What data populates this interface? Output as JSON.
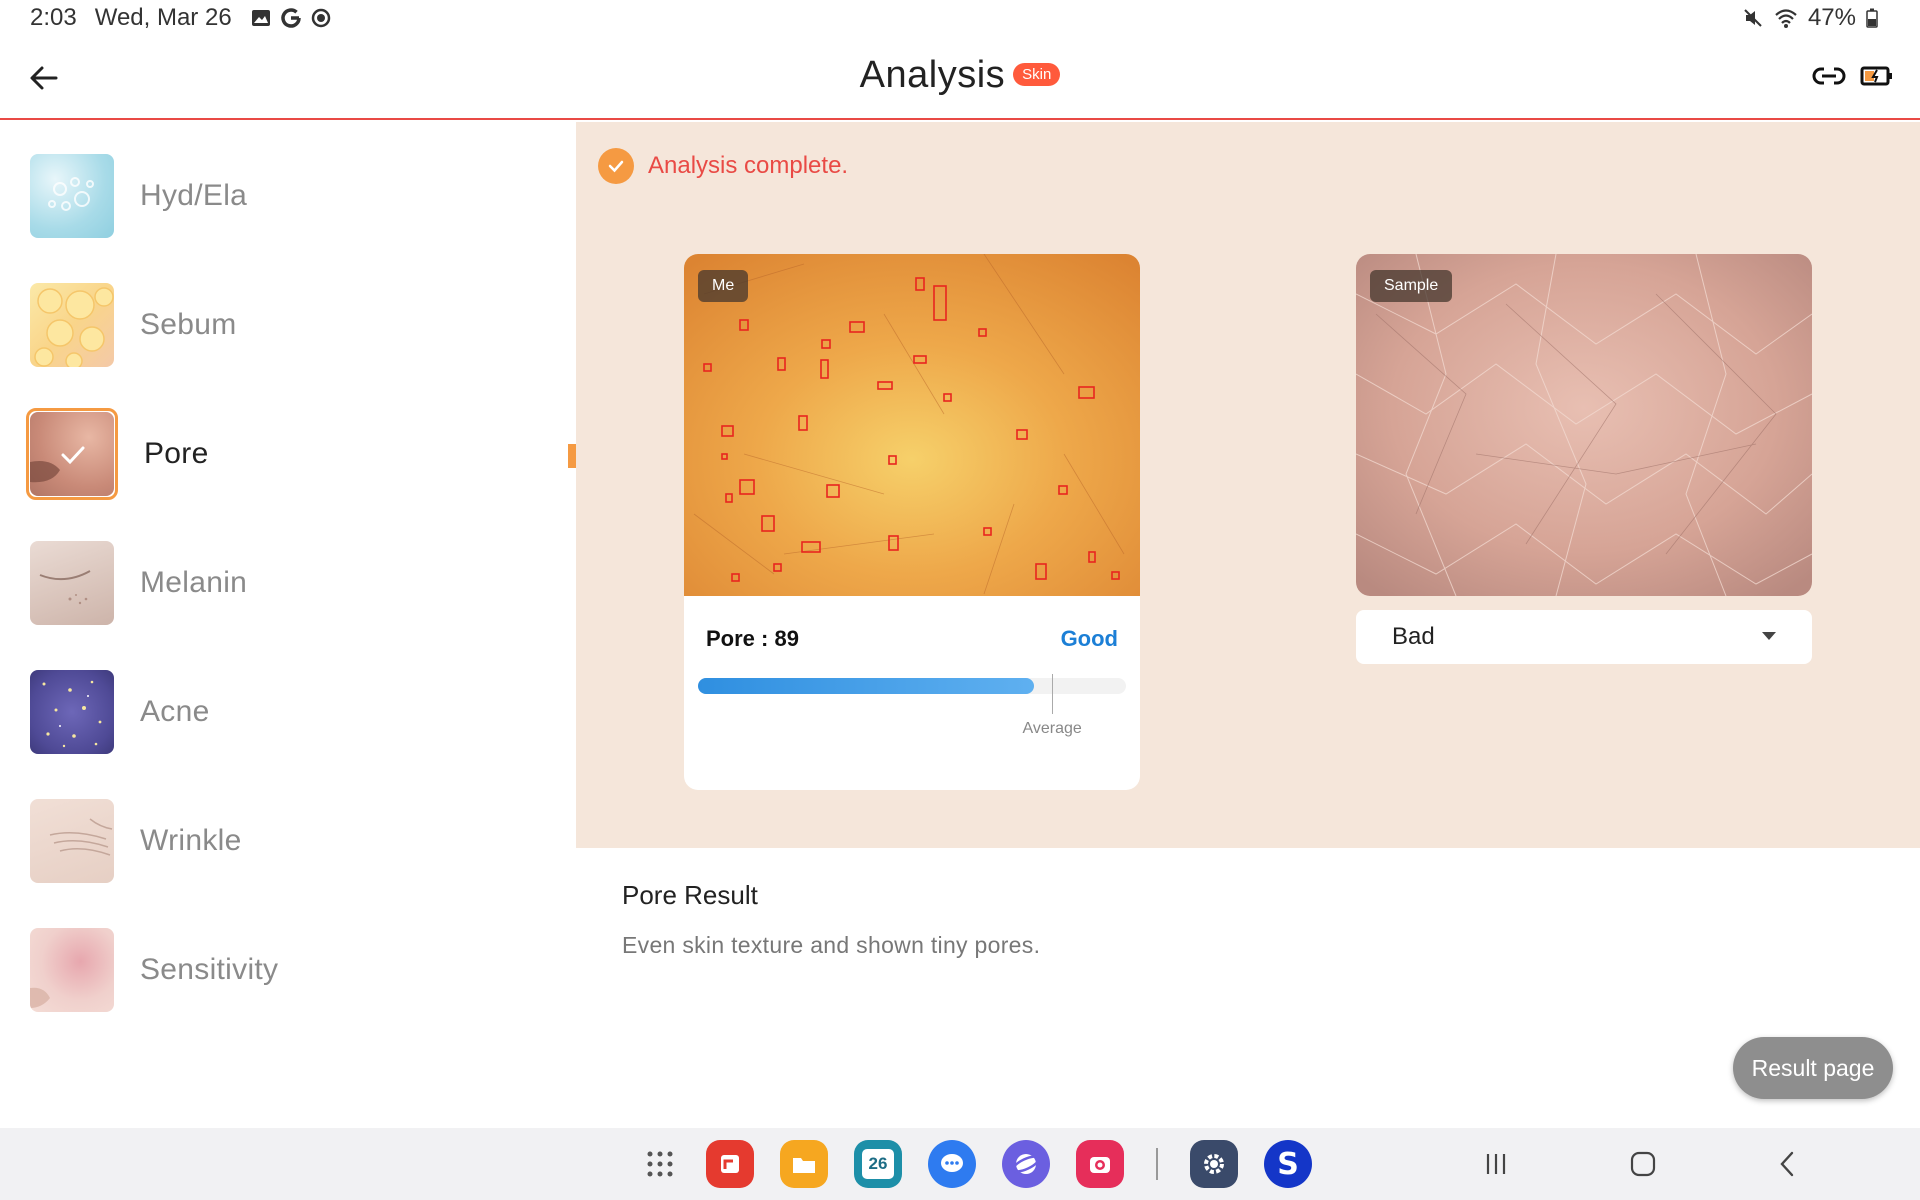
{
  "status_bar": {
    "time": "2:03",
    "date": "Wed, Mar 26",
    "battery": "47%"
  },
  "header": {
    "title": "Analysis",
    "badge": "Skin"
  },
  "sidebar": {
    "items": [
      {
        "label": "Hyd/Ela",
        "selected": false
      },
      {
        "label": "Sebum",
        "selected": false
      },
      {
        "label": "Pore",
        "selected": true
      },
      {
        "label": "Melanin",
        "selected": false
      },
      {
        "label": "Acne",
        "selected": false
      },
      {
        "label": "Wrinkle",
        "selected": false
      },
      {
        "label": "Sensitivity",
        "selected": false
      }
    ]
  },
  "analysis": {
    "status": "Analysis complete.",
    "me_tag": "Me",
    "sample_tag": "Sample",
    "score_label": "Pore : 89",
    "score_value": 89,
    "grade": "Good",
    "average_label": "Average",
    "average_fraction": 0.81,
    "score_fraction": 0.89,
    "sample_select": "Bad"
  },
  "result": {
    "title": "Pore Result",
    "description": "Even skin texture and shown tiny pores.",
    "button": "Result page"
  },
  "dock": {
    "calendar_day": "26"
  },
  "colors": {
    "accent": "#f59a42",
    "header_line": "#e94a45",
    "badge": "#ff5a3c",
    "grade": "#1c7fd6",
    "panel_bg": "#f5e6da"
  }
}
